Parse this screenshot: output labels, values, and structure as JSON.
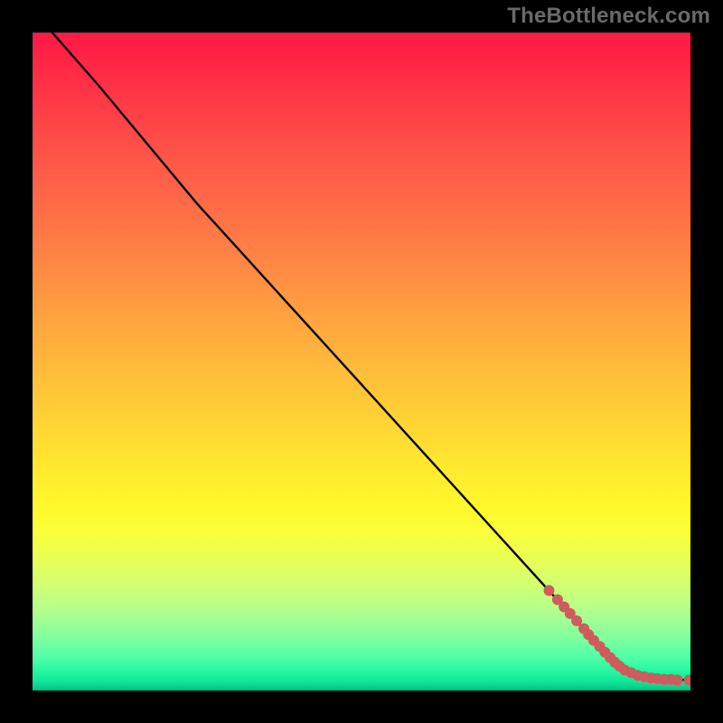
{
  "watermark": "TheBottleneck.com",
  "chart_data": {
    "type": "line",
    "title": "",
    "xlabel": "",
    "ylabel": "",
    "xlim": [
      0,
      100
    ],
    "ylim": [
      0,
      100
    ],
    "series": [
      {
        "name": "curve",
        "x": [
          3,
          10,
          15,
          20,
          25,
          30,
          40,
          50,
          60,
          70,
          78,
          82,
          85,
          87,
          89,
          90,
          92,
          94,
          96,
          98,
          100
        ],
        "values": [
          100,
          92,
          86,
          80,
          74,
          68.5,
          57.5,
          46.5,
          35.5,
          24.5,
          15.7,
          11.3,
          8.0,
          5.8,
          3.9,
          3.0,
          2.3,
          1.9,
          1.7,
          1.6,
          1.6
        ]
      },
      {
        "name": "scatter",
        "x": [
          78.5,
          79.8,
          80.8,
          81.7,
          82.7,
          83.8,
          84.5,
          85.3,
          86.2,
          87.0,
          87.8,
          88.5,
          89.2,
          90.0,
          91.0,
          92.0,
          93.0,
          94.0,
          95.0,
          96.0,
          97.0,
          98.0,
          99.8
        ],
        "values": [
          15.2,
          13.8,
          12.7,
          11.7,
          10.6,
          9.4,
          8.5,
          7.6,
          6.7,
          5.8,
          5.0,
          4.3,
          3.7,
          3.1,
          2.7,
          2.3,
          2.1,
          1.9,
          1.8,
          1.7,
          1.7,
          1.6,
          1.6
        ]
      }
    ],
    "curve_color": "#000000",
    "scatter_color": "#cd5c5c",
    "scatter_radius": 6
  }
}
